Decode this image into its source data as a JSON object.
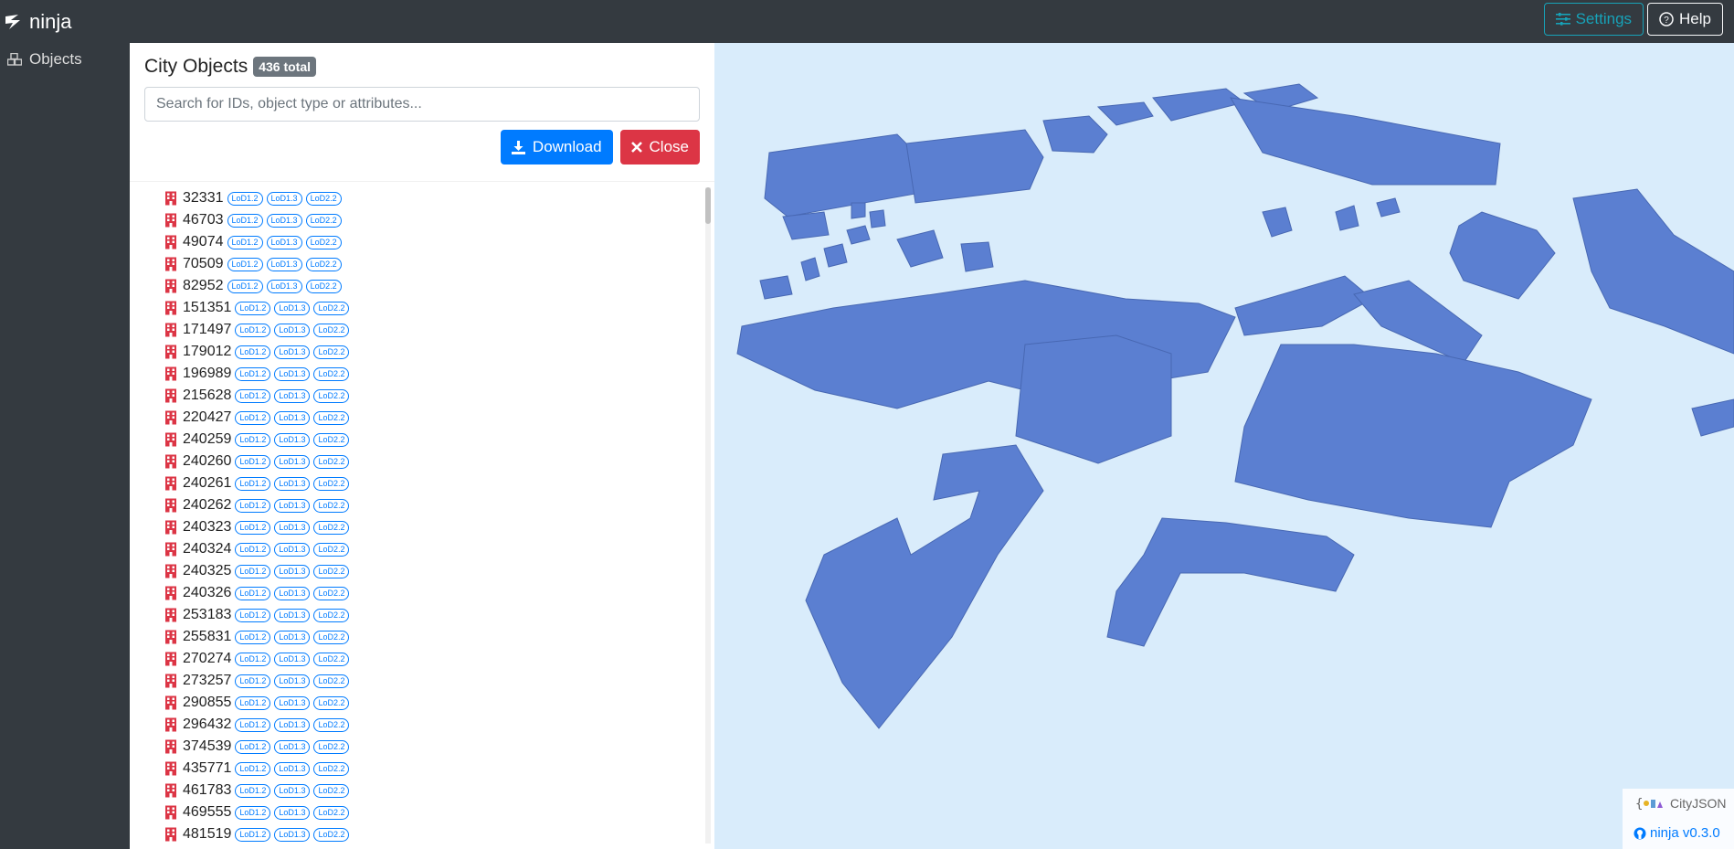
{
  "navbar": {
    "brand": "ninja",
    "settings_label": "Settings",
    "help_label": "Help"
  },
  "sidebar": {
    "items": [
      {
        "label": "Objects",
        "icon": "cubes-icon"
      }
    ]
  },
  "panel": {
    "title": "City Objects",
    "total_badge": "436 total",
    "search_placeholder": "Search for IDs, object type or attributes...",
    "download_label": "Download",
    "close_label": "Close",
    "lod_labels": [
      "LoD1.2",
      "LoD1.3",
      "LoD2.2"
    ],
    "objects": [
      {
        "id": "32331"
      },
      {
        "id": "46703"
      },
      {
        "id": "49074"
      },
      {
        "id": "70509"
      },
      {
        "id": "82952"
      },
      {
        "id": "151351"
      },
      {
        "id": "171497"
      },
      {
        "id": "179012"
      },
      {
        "id": "196989"
      },
      {
        "id": "215628"
      },
      {
        "id": "220427"
      },
      {
        "id": "240259"
      },
      {
        "id": "240260"
      },
      {
        "id": "240261"
      },
      {
        "id": "240262"
      },
      {
        "id": "240323"
      },
      {
        "id": "240324"
      },
      {
        "id": "240325"
      },
      {
        "id": "240326"
      },
      {
        "id": "253183"
      },
      {
        "id": "255831"
      },
      {
        "id": "270274"
      },
      {
        "id": "273257"
      },
      {
        "id": "290855"
      },
      {
        "id": "296432"
      },
      {
        "id": "374539"
      },
      {
        "id": "435771"
      },
      {
        "id": "461783"
      },
      {
        "id": "469555"
      },
      {
        "id": "481519"
      }
    ]
  },
  "viewer": {
    "cityjson_logo_text": "CityJSON",
    "version_link": "ninja v0.3.0"
  },
  "colors": {
    "navbar_bg": "#343a40",
    "viewer_bg": "#d9ecfb",
    "building": "#5b7fd1",
    "building_icon": "#dc3545",
    "primary": "#007bff",
    "danger": "#dc3545",
    "info": "#17a2b8"
  }
}
